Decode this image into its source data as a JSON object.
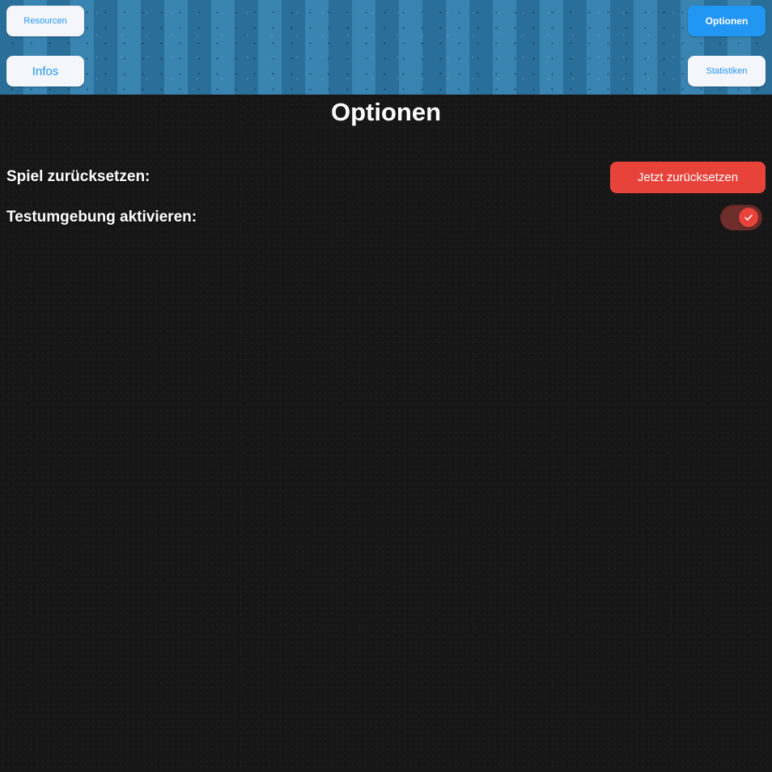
{
  "header": {
    "resources_label": "Resourcen",
    "info_label": "Infos",
    "options_label": "Optionen",
    "stats_label": "Statistiken"
  },
  "page": {
    "title": "Optionen"
  },
  "settings": {
    "reset_label": "Spiel zurücksetzen:",
    "reset_button": "Jetzt zurücksetzen",
    "testenv_label": "Testumgebung aktivieren:",
    "testenv_enabled": true
  },
  "colors": {
    "accent_blue": "#2196f3",
    "danger_red": "#e8433b",
    "background": "#171717"
  },
  "icons": {
    "toggle_check": "checkmark-icon"
  }
}
